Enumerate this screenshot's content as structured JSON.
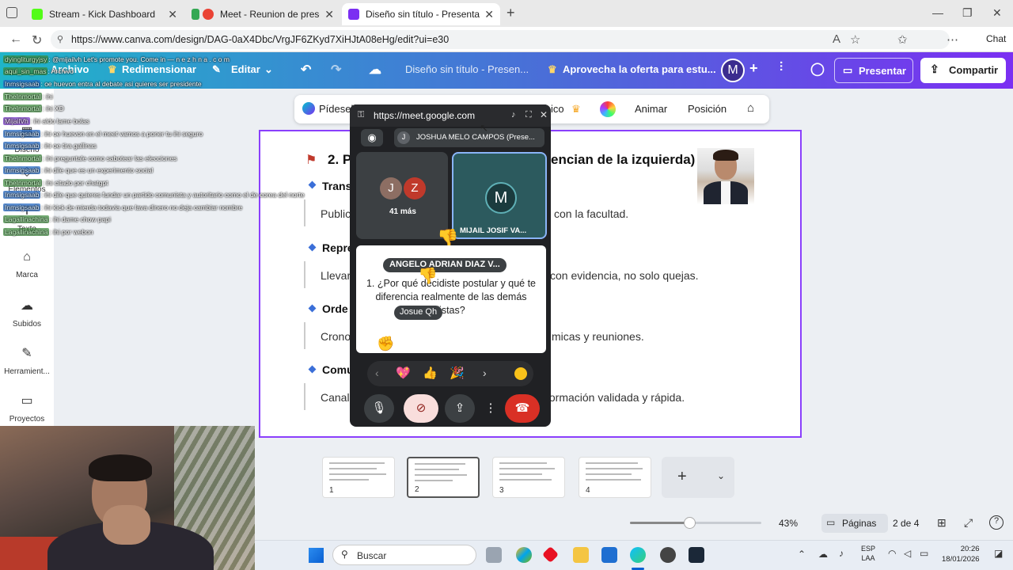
{
  "browser": {
    "tabs": [
      {
        "label": "Stream - Kick Dashboard",
        "icon": "kick-icon",
        "color": "#53fc18"
      },
      {
        "label": "Meet - Reunion de presentació",
        "icon": "meet-icon",
        "color": "#ea4335"
      },
      {
        "label": "Diseño sin título - Presentación",
        "icon": "canva-icon",
        "color": "#7b2ff2"
      }
    ],
    "url": "https://www.canva.com/design/DAG-0aX4Dbc/VrgJF6ZKyd7XiHJtA08eHg/edit?ui=e30",
    "chat_label": "Chat"
  },
  "canva": {
    "file_label": "Archivo",
    "resize_label": "Redimensionar",
    "edit_label": "Editar",
    "doc_title": "Diseño sin título - Presen...",
    "offer_label": "Aprovecha la oferta para estu...",
    "avatar_letter": "M",
    "present_label": "Presentar",
    "share_label": "Compartir"
  },
  "sidebar": [
    {
      "label": "Diseño",
      "icon": "design-icon"
    },
    {
      "label": "Elementos",
      "icon": "elements-icon"
    },
    {
      "label": "Texto",
      "icon": "text-icon"
    },
    {
      "label": "Marca",
      "icon": "brand-icon"
    },
    {
      "label": "Subidos",
      "icon": "upload-icon"
    },
    {
      "label": "Herramient...",
      "icon": "tools-icon"
    },
    {
      "label": "Proyectos",
      "icon": "folder-icon"
    }
  ],
  "editor_toolbar": {
    "ask_label": "Pídeselo",
    "effects_label": "ico",
    "animate_label": "Animar",
    "position_label": "Posición"
  },
  "slide": {
    "heading_left": "2. P",
    "heading_right": "encian de la izquierda)",
    "bullets": [
      {
        "title": "Trans",
        "body_left": "Public",
        "body_right": "con la facultad."
      },
      {
        "title": "Repre",
        "body_left": "Llevar",
        "body_right": "con evidencia, no solo quejas."
      },
      {
        "title": "Orde",
        "body_left": "Crono",
        "body_right": "micas y reuniones."
      },
      {
        "title": "Comu",
        "body_left": "Canal",
        "body_right": "formación validada y rápida."
      }
    ]
  },
  "thumbnails": [
    {
      "num": "1",
      "selected": false
    },
    {
      "num": "2",
      "selected": true
    },
    {
      "num": "3",
      "selected": false
    },
    {
      "num": "4",
      "selected": false
    }
  ],
  "footer": {
    "zoom": "43%",
    "zoom_fraction": 0.45,
    "pages_label": "Páginas",
    "page_count": "2 de 4"
  },
  "chat": [
    {
      "user": "dyingliturgyjsy",
      "text": ": @mijailvh Let's promote  you. Come  in — n e z h n a . c o m",
      "style": "green"
    },
    {
      "user": "aqui_sin_mas",
      "text": ": Archivo",
      "style": "green"
    },
    {
      "user": "Inmsigsaab",
      "text": ": oe huevon entra al debate asi quieres ser presidente",
      "style": "blue"
    },
    {
      "user": "TheInmortal",
      "text": ": ihi",
      "style": "green"
    },
    {
      "user": "TheInmortal",
      "text": ": ihi XD",
      "style": "green"
    },
    {
      "user": "MijailVh",
      "text": ": ihi aldo lame bolas",
      "style": "purple"
    },
    {
      "user": "Inmsigsaab",
      "text": ": ihi oe huevon en el meet vamos a poner tu ihi seguro",
      "style": "blue"
    },
    {
      "user": "Inmsigsaab",
      "text": ": ihi oe tira gallinas",
      "style": "blue"
    },
    {
      "user": "TheInmortal",
      "text": ": ihi preguntale como sabotear las elecciones",
      "style": "green"
    },
    {
      "user": "Inmsigsaab",
      "text": ": ihi dile que es un experimento social",
      "style": "blue"
    },
    {
      "user": "TheInmortal",
      "text": ": ihi citado por chatgpt",
      "style": "green"
    },
    {
      "user": "Inmsigsaab",
      "text": ": ihi dile que quieres fundar un partido comunista y autoritario como el de corea del norte",
      "style": "blue"
    },
    {
      "user": "Inmsigsaab",
      "text": ": ihi kick de mierda todavia que lava dinero no deja cambiar nombre",
      "style": "blue"
    },
    {
      "user": "Lagallinachina",
      "text": ": ihi dame chow papi",
      "style": "green"
    },
    {
      "user": "Lagallinachina",
      "text": ": ihi por webon",
      "style": "green"
    }
  ],
  "meet": {
    "url": "https://meet.google.com",
    "presenter": "JOSHUA MELO CAMPOS (Prese...",
    "presenter_initial": "J",
    "group_initials": [
      "J",
      "Z"
    ],
    "group_label": "41 más",
    "self_initial": "M",
    "self_name": "MIJAIL JOSIF VA...",
    "shared_name": "ANGELO ADRIAN DIAZ V...",
    "shared_text_1": "1. ¿Por qué decidiste postular y qué te",
    "shared_text_2": "diferencia realmente de las demás",
    "shared_text_3": "listas?",
    "cursor_label": "Josue Qh",
    "reactions": [
      "💖",
      "👍",
      "🎉"
    ]
  },
  "taskbar": {
    "search_placeholder": "Buscar",
    "lang_top": "ESP",
    "lang_bottom": "LAA",
    "time": "20:26",
    "date": "18/01/2026"
  }
}
